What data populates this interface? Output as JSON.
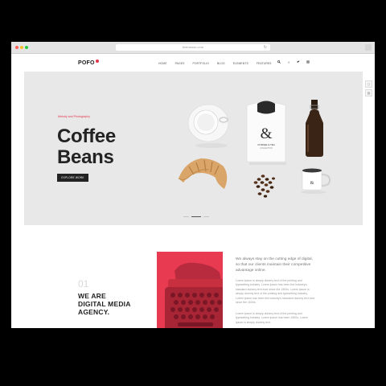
{
  "browser": {
    "url": "themeuse.com"
  },
  "site": {
    "logo": "POFO",
    "logo_color": "#e5374c",
    "menu": [
      "HOME",
      "PAGES",
      "PORTFOLIO",
      "BLOG",
      "ELEMENTS",
      "FEATURES"
    ],
    "icons": [
      "search-icon",
      "facebook-icon",
      "twitter-icon",
      "instagram-icon"
    ]
  },
  "hero": {
    "eyebrow": "Melody and Photography",
    "title_line1": "Coffee",
    "title_line2": "Beans",
    "cta": "EXPLORE WORK",
    "bag_label": "COFFEE & TEA",
    "bag_sub": "COLLECTION",
    "slide_count": 3,
    "active_slide": 2
  },
  "about": {
    "number": "01",
    "heading_line1": "WE ARE",
    "heading_line2": "DIGITAL MEDIA",
    "heading_line3": "AGENCY.",
    "lead": "We always stay on the cutting edge of digital, so that our clients maintain their competitive advantage online.",
    "para1": "Lorem ipsum is simply dummy text of the printing and typesetting industry. Lorem ipsum has been the industry's standard dummy text ever since the 1500s. Lorem ipsum is simply dummy text of the printing and typesetting industry. Lorem ipsum has been the industry's standard dummy text ever since the 1500s.",
    "para2": "Lorem ipsum is simply dummy text of the printing and typesetting industry. Lorem ipsum has been 1500s. Lorem ipsum is simply dummy text."
  }
}
